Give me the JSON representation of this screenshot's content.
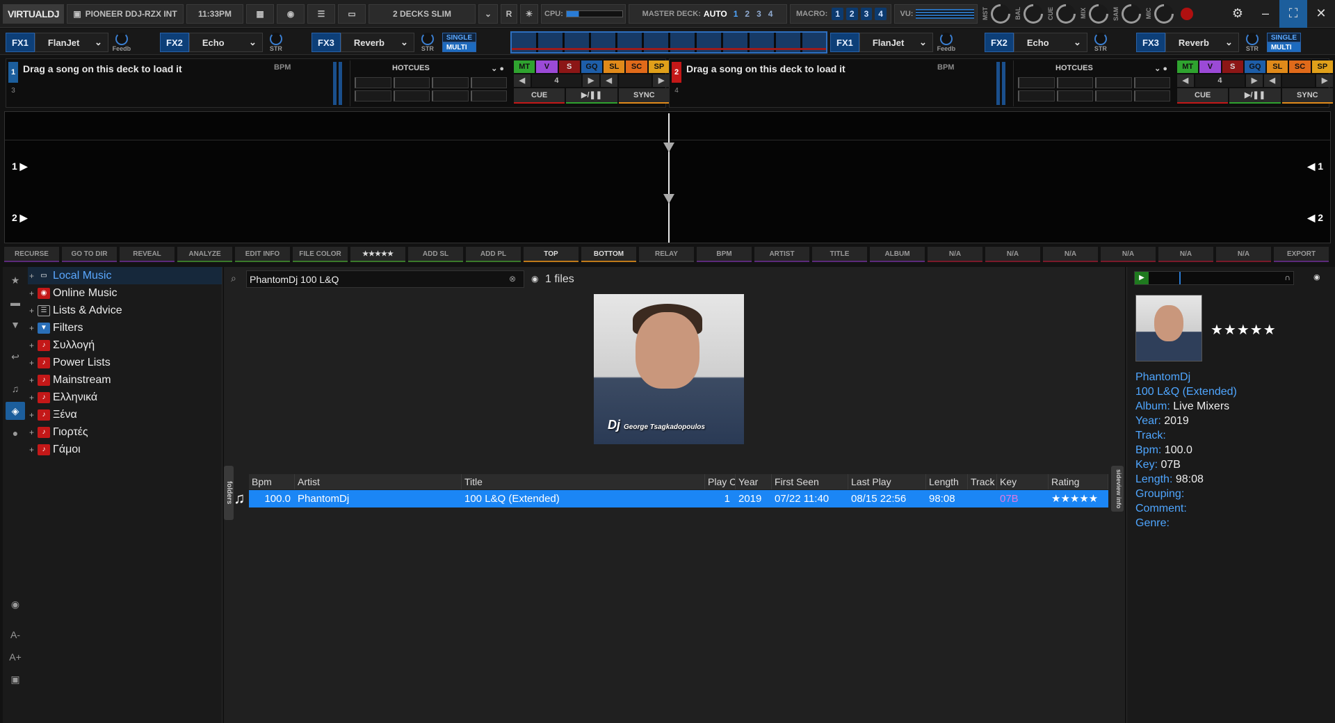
{
  "topbar": {
    "logo": "VIRTUALDJ",
    "controller": "PIONEER DDJ-RZX INT",
    "time": "11:33PM",
    "layout": "2 DECKS SLIM",
    "r_label": "R",
    "cpu_label": "CPU:",
    "master_deck_label": "MASTER DECK:",
    "master_deck_value": "AUTO",
    "master_decks": [
      "1",
      "2",
      "3",
      "4"
    ],
    "macro_label": "MACRO:",
    "macros": [
      "1",
      "2",
      "3",
      "4"
    ],
    "vu_label": "VU:",
    "knobs": [
      "MST",
      "BAL",
      "CUE",
      "MIX",
      "SAM",
      "MIC"
    ]
  },
  "fx": {
    "left": [
      {
        "tag": "FX1",
        "effect": "FlanJet",
        "knob": "Feedb"
      },
      {
        "tag": "FX2",
        "effect": "Echo",
        "knob": "STR"
      },
      {
        "tag": "FX3",
        "effect": "Reverb",
        "knob": "STR"
      }
    ],
    "right": [
      {
        "tag": "FX1",
        "effect": "FlanJet",
        "knob": "Feedb"
      },
      {
        "tag": "FX2",
        "effect": "Echo",
        "knob": "STR"
      },
      {
        "tag": "FX3",
        "effect": "Reverb",
        "knob": "STR"
      }
    ],
    "single": "SINGLE",
    "multi": "MULTI"
  },
  "decks": [
    {
      "num": "1",
      "alt": "3",
      "color": "#1c5e9c",
      "title": "Drag a song on this deck to load it",
      "bpm": "BPM",
      "hotcues": "HOTCUES",
      "cue": "CUE",
      "play": "▶/❚❚",
      "sync": "SYNC",
      "loop": "4"
    },
    {
      "num": "2",
      "alt": "4",
      "color": "#c41818",
      "title": "Drag a song on this deck to load it",
      "bpm": "BPM",
      "hotcues": "HOTCUES",
      "cue": "CUE",
      "play": "▶/❚❚",
      "sync": "SYNC",
      "loop": "4"
    }
  ],
  "pads": [
    "MT",
    "V",
    "S",
    "GQ",
    "SL",
    "SC",
    "SP"
  ],
  "waveform": {
    "left1": "1 ▶",
    "left2": "2 ▶",
    "right1": "◀ 1",
    "right2": "◀ 2"
  },
  "toolbar": [
    "RECURSE",
    "GO TO DIR",
    "REVEAL",
    "ANALYZE",
    "EDIT INFO",
    "FILE COLOR",
    "★★★★★",
    "ADD SL",
    "ADD PL",
    "TOP",
    "BOTTOM",
    "RELAY",
    "BPM",
    "ARTIST",
    "TITLE",
    "ALBUM",
    "N/A",
    "N/A",
    "N/A",
    "N/A",
    "N/A",
    "N/A",
    "EXPORT"
  ],
  "tree": [
    {
      "label": "Local Music",
      "icon": "computer-icon",
      "color": "#2a6fb8"
    },
    {
      "label": "Online Music",
      "icon": "online-icon",
      "color": "#c41818"
    },
    {
      "label": "Lists & Advice",
      "icon": "list-icon",
      "color": "#555555"
    },
    {
      "label": "Filters",
      "icon": "folder-icon",
      "color": "#2a6fb8"
    },
    {
      "label": "Συλλογή",
      "icon": "playlist-icon",
      "color": "#c41818"
    },
    {
      "label": "Power Lists",
      "icon": "playlist-icon",
      "color": "#c41818"
    },
    {
      "label": "Mainstream",
      "icon": "playlist-icon",
      "color": "#c41818"
    },
    {
      "label": "Ελληνικά",
      "icon": "playlist-icon",
      "color": "#c41818"
    },
    {
      "label": "Ξένα",
      "icon": "playlist-icon",
      "color": "#c41818"
    },
    {
      "label": "Γιορτές",
      "icon": "playlist-icon",
      "color": "#c41818"
    },
    {
      "label": "Γάμοι",
      "icon": "playlist-icon",
      "color": "#c41818"
    }
  ],
  "search": {
    "value": "PhantomDj 100 L&Q",
    "file_count": "1 files"
  },
  "cover_text": {
    "main": "Dj",
    "sub": "George Tsagkadopoulos"
  },
  "grid": {
    "columns": [
      "Bpm",
      "Artist",
      "Title",
      "Play C",
      "Year",
      "First Seen",
      "Last Play",
      "Length",
      "Track",
      "Key",
      "Rating"
    ],
    "row": {
      "bpm": "100.0",
      "artist": "PhantomDj",
      "title": "100 L&Q (Extended)",
      "play": "1",
      "year": "2019",
      "first_seen": "07/22 11:40",
      "last_play": "08/15 22:56",
      "length": "98:08",
      "track": "",
      "key": "07B",
      "rating": "★★★★★"
    }
  },
  "tabs": {
    "folders": "folders",
    "sideview": "sideview",
    "info": "info"
  },
  "info": {
    "stars": "★★★★★",
    "artist": "PhantomDj",
    "title": "100 L&Q (Extended)",
    "album_label": "Album:",
    "album": "Live Mixers",
    "year_label": "Year:",
    "year": "2019",
    "track_label": "Track:",
    "bpm_label": "Bpm:",
    "bpm": "100.0",
    "key_label": "Key:",
    "key": "07B",
    "length_label": "Length:",
    "length": "98:08",
    "grouping_label": "Grouping:",
    "comment_label": "Comment:",
    "genre_label": "Genre:"
  }
}
